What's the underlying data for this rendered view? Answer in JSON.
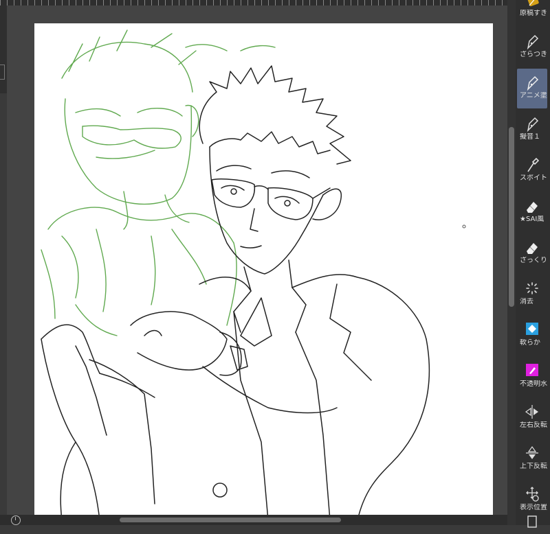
{
  "tools": [
    {
      "id": "genkou",
      "label": "原稿すき",
      "icon": "pencil-icon"
    },
    {
      "id": "zaratsuki",
      "label": "ざらつき",
      "icon": "pen-nib-icon"
    },
    {
      "id": "anime",
      "label": "アニメ塗",
      "icon": "pen-nib-icon",
      "selected": true
    },
    {
      "id": "giongo",
      "label": "擬音１",
      "icon": "pen-nib-icon"
    },
    {
      "id": "spoit",
      "label": "スポイト",
      "icon": "eyedropper-icon"
    },
    {
      "id": "sai",
      "label": "★SAI風",
      "icon": "eraser-icon"
    },
    {
      "id": "zakkuri",
      "label": "ざっくり",
      "icon": "eraser-icon"
    },
    {
      "id": "shokyo",
      "label": "消去",
      "icon": "clear-burst-icon"
    },
    {
      "id": "yawaraka",
      "label": "軟らか",
      "icon": "soft-eraser-icon",
      "color": "#2aa0e0"
    },
    {
      "id": "futoumei",
      "label": "不透明水",
      "icon": "opaque-water-icon",
      "color": "#e020e0"
    },
    {
      "id": "sayuu",
      "label": "左右反転",
      "icon": "flip-horizontal-icon"
    },
    {
      "id": "jouge",
      "label": "上下反転",
      "icon": "flip-vertical-icon"
    },
    {
      "id": "hyouji",
      "label": "表示位置",
      "icon": "move-view-icon"
    }
  ],
  "colors": {
    "sketch_green": "#4fa03c",
    "lineart": "#222222",
    "selected_tool": "#5b6a88"
  }
}
